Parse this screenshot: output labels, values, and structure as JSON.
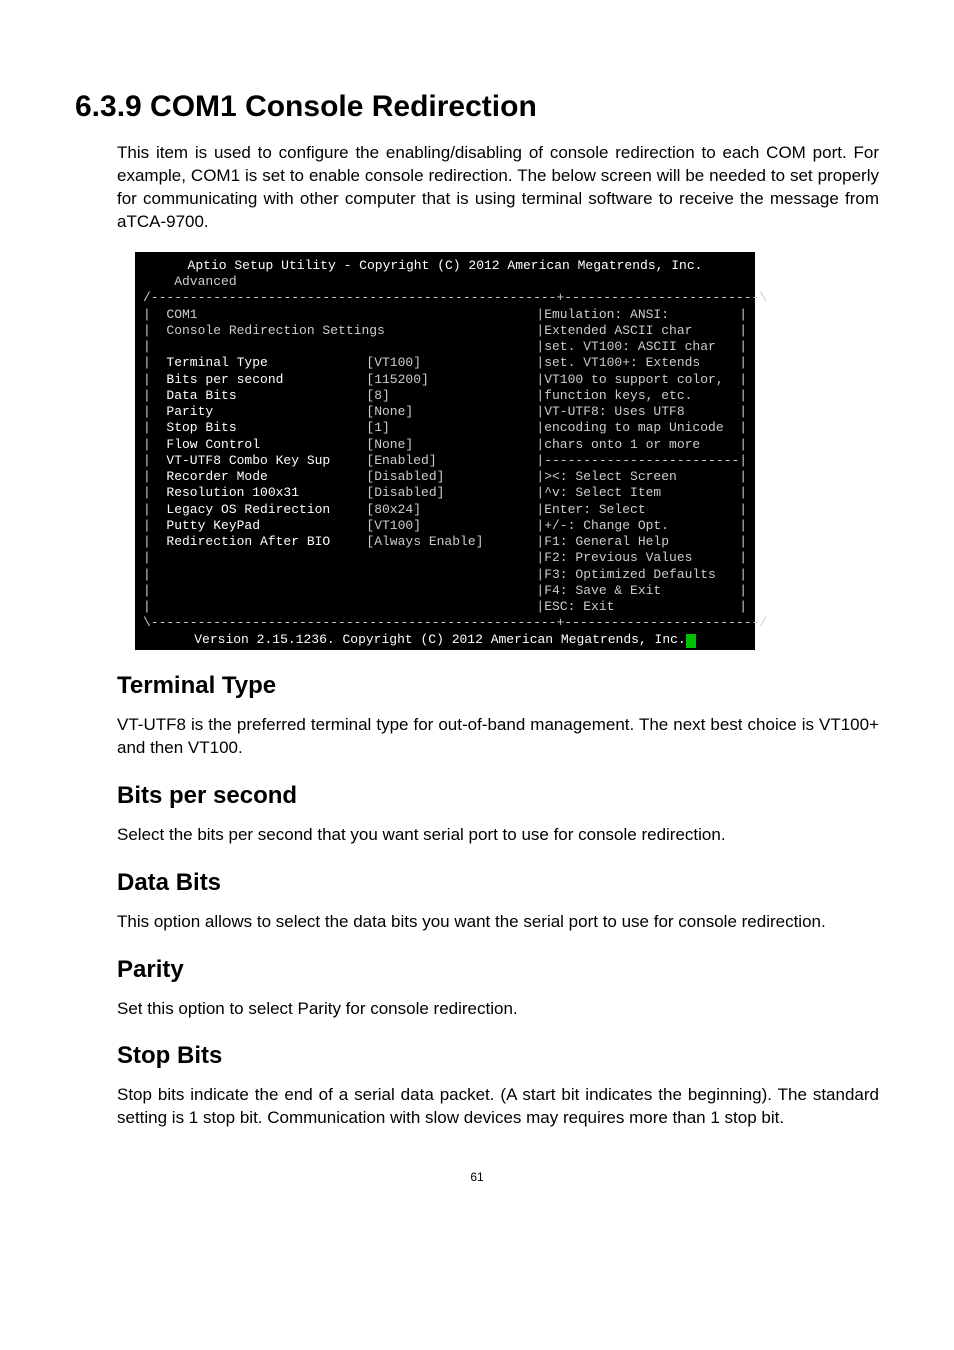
{
  "title": "6.3.9    COM1 Console Redirection",
  "intro": "This item is used to configure the enabling/disabling of console redirection to each COM port. For example, COM1 is set to enable console redirection. The below screen will be needed to set properly for communicating with other computer that is using terminal software to receive the message from aTCA-9700.",
  "terminal": {
    "top": "Aptio Setup Utility - Copyright (C) 2012 American Megatrends, Inc.",
    "menu": "    Advanced",
    "divider_top": "/----------------------------------------------------+-------------------------\\",
    "rows": [
      {
        "left": "|  ",
        "label": "COM1",
        "value": "",
        "help": "|Emulation: ANSI:",
        "lblDim": true,
        "right": "|"
      },
      {
        "left": "|  ",
        "label": "Console Redirection Settings",
        "value": "",
        "help": "|Extended ASCII char",
        "lblDim": true,
        "right": "|"
      },
      {
        "left": "|  ",
        "label": "",
        "value": "",
        "help": "|set. VT100: ASCII char",
        "lblDim": true,
        "right": "|"
      },
      {
        "left": "|  ",
        "label": "Terminal Type",
        "value": "[VT100]",
        "help": "|set. VT100+: Extends",
        "lblDim": false,
        "right": "|"
      },
      {
        "left": "|  ",
        "label": "Bits per second",
        "value": "[115200]",
        "help": "|VT100 to support color,",
        "lblDim": false,
        "right": "|"
      },
      {
        "left": "|  ",
        "label": "Data Bits",
        "value": "[8]",
        "help": "|function keys, etc.",
        "lblDim": false,
        "right": "|"
      },
      {
        "left": "|  ",
        "label": "Parity",
        "value": "[None]",
        "help": "|VT-UTF8: Uses UTF8",
        "lblDim": false,
        "right": "|"
      },
      {
        "left": "|  ",
        "label": "Stop Bits",
        "value": "[1]",
        "help": "|encoding to map Unicode",
        "lblDim": false,
        "right": "|"
      },
      {
        "left": "|  ",
        "label": "Flow Control",
        "value": "[None]",
        "help": "|chars onto 1 or more",
        "lblDim": false,
        "right": "|"
      },
      {
        "left": "|  ",
        "label": "VT-UTF8 Combo Key Sup",
        "value": "[Enabled]",
        "help": "|-------------------------",
        "lblDim": false,
        "right": "|"
      },
      {
        "left": "|  ",
        "label": "Recorder Mode",
        "value": "[Disabled]",
        "help": "|><: Select Screen",
        "lblDim": false,
        "right": "|"
      },
      {
        "left": "|  ",
        "label": "Resolution 100x31",
        "value": "[Disabled]",
        "help": "|^v: Select Item",
        "lblDim": false,
        "right": "|"
      },
      {
        "left": "|  ",
        "label": "Legacy OS Redirection",
        "value": "[80x24]",
        "help": "|Enter: Select",
        "lblDim": false,
        "right": "|"
      },
      {
        "left": "|  ",
        "label": "Putty KeyPad",
        "value": "[VT100]",
        "help": "|+/-: Change Opt.",
        "lblDim": false,
        "right": "|"
      },
      {
        "left": "|  ",
        "label": "Redirection After BIO",
        "value": "[Always Enable]",
        "help": "|F1: General Help",
        "lblDim": false,
        "right": "|"
      },
      {
        "left": "|  ",
        "label": "",
        "value": "",
        "help": "|F2: Previous Values",
        "lblDim": true,
        "right": "|"
      },
      {
        "left": "|  ",
        "label": "",
        "value": "",
        "help": "|F3: Optimized Defaults",
        "lblDim": true,
        "right": "|"
      },
      {
        "left": "|  ",
        "label": "",
        "value": "",
        "help": "|F4: Save & Exit",
        "lblDim": true,
        "right": "|"
      },
      {
        "left": "|  ",
        "label": "",
        "value": "",
        "help": "|ESC: Exit",
        "lblDim": true,
        "right": "|"
      }
    ],
    "divider_bottom": "\\----------------------------------------------------+-------------------------/",
    "footer": "Version 2.15.1236. Copyright (C) 2012 American Megatrends, Inc."
  },
  "sections": [
    {
      "heading": "Terminal Type",
      "body": "VT-UTF8 is the preferred terminal type for out-of-band management. The next best choice is VT100+ and then VT100."
    },
    {
      "heading": "Bits per second",
      "body": "Select the bits per second that you want serial port to use for console redirection."
    },
    {
      "heading": "Data Bits",
      "body": "This option allows to select the data bits you want the serial port to use for console redirection."
    },
    {
      "heading": "Parity",
      "body": "Set this option to select Parity for console redirection."
    },
    {
      "heading": "Stop Bits",
      "body": "Stop bits indicate the end of a serial data packet. (A start bit indicates the beginning). The standard setting is 1 stop bit. Communication with slow devices may requires more than 1 stop bit."
    }
  ],
  "pagenum": "61"
}
